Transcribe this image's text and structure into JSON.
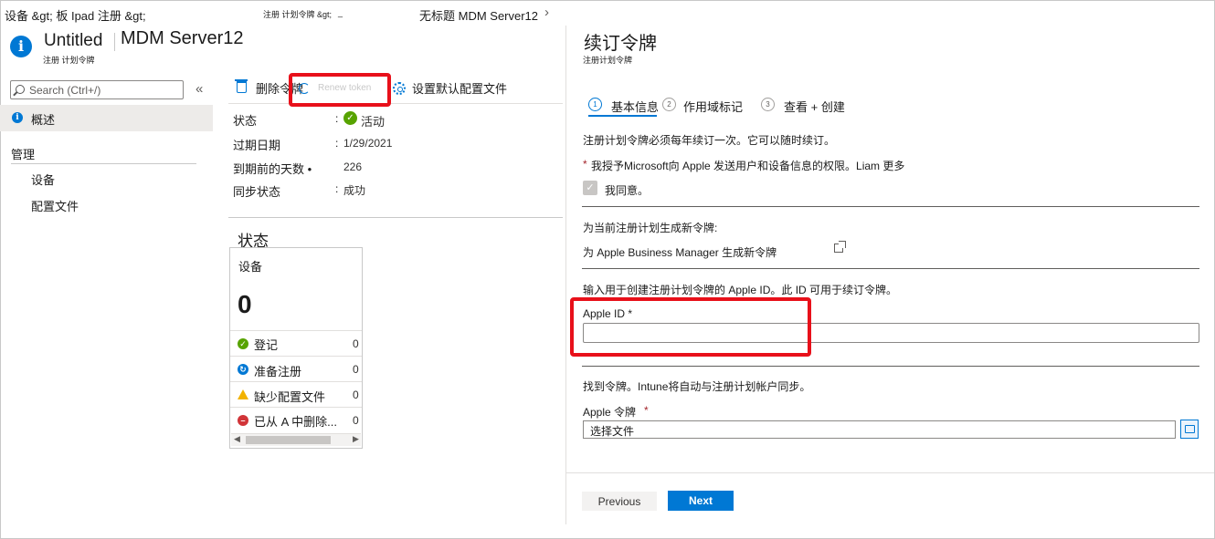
{
  "breadcrumb": {
    "root": "设备 &gt; 板 Ipad 注册 &gt;",
    "middle": "注册 计划令牌 &gt;",
    "middle_tail": "_",
    "current": "无标题 MDM Server12",
    "chevron": "›"
  },
  "header": {
    "title": "Untitled",
    "server_name": "MDM Server12",
    "subtitle": "注册 计划令牌"
  },
  "search": {
    "placeholder": "Search (Ctrl+/)",
    "collapse": "«"
  },
  "sidebar": {
    "overview": "概述",
    "manage_heading": "管理",
    "items": [
      "设备",
      "配置文件"
    ]
  },
  "toolbar": {
    "delete_label": "删除令牌",
    "renew_label": "Renew token",
    "set_default_label": "设置默认配置文件"
  },
  "properties": [
    {
      "label": "状态",
      "colon": ":",
      "value": "活动"
    },
    {
      "label": "过期日期",
      "colon": ":",
      "value": "1/29/2021"
    },
    {
      "label": "到期前的天数 •",
      "colon": "",
      "value": "226"
    },
    {
      "label": "同步状态",
      "colon": ":",
      "value": "成功"
    }
  ],
  "status_section": {
    "heading": "状态",
    "card_title": "设备",
    "total": "0",
    "rows": [
      {
        "label": "登记",
        "count": "0",
        "color": "#57a300"
      },
      {
        "label": "准备注册",
        "count": "0",
        "color": "#0078d4"
      },
      {
        "label": "缺少配置文件",
        "count": "0",
        "color": "#f2b200"
      },
      {
        "label": "已从 A 中删除...",
        "count": "0",
        "color": "#d13438"
      }
    ],
    "scroll_left": "◀",
    "scroll_right": "▶"
  },
  "panel": {
    "title": "续订令牌",
    "subtitle": "注册计划令牌",
    "steps": [
      {
        "num": "1",
        "label": "基本信息"
      },
      {
        "num": "2",
        "label": "作用域标记"
      },
      {
        "num": "3",
        "label": "查看 + 创建"
      }
    ],
    "renew_info": "注册计划令牌必须每年续订一次。它可以随时续订。",
    "consent_star": "*",
    "consent_text": "我授予Microsoft向 Apple 发送用户和设备信息的权限。Liam 更多",
    "agree_label": "我同意。",
    "generate_heading": "为当前注册计划生成新令牌:",
    "generate_link": "为 Apple Business Manager 生成新令牌",
    "appleid_info": "输入用于创建注册计划令牌的 Apple ID。此 ID 可用于续订令牌。",
    "appleid_label": "Apple ID *",
    "appleid_value": "",
    "find_token_info": "找到令牌。Intune将自动与注册计划帐户同步。",
    "token_label": "Apple 令牌",
    "token_required": "*",
    "file_placeholder": "选择文件",
    "previous_label": "Previous",
    "next_label": "Next"
  },
  "colors": {
    "accent": "#0078d4",
    "highlight": "#e8101a",
    "success": "#57a300"
  }
}
